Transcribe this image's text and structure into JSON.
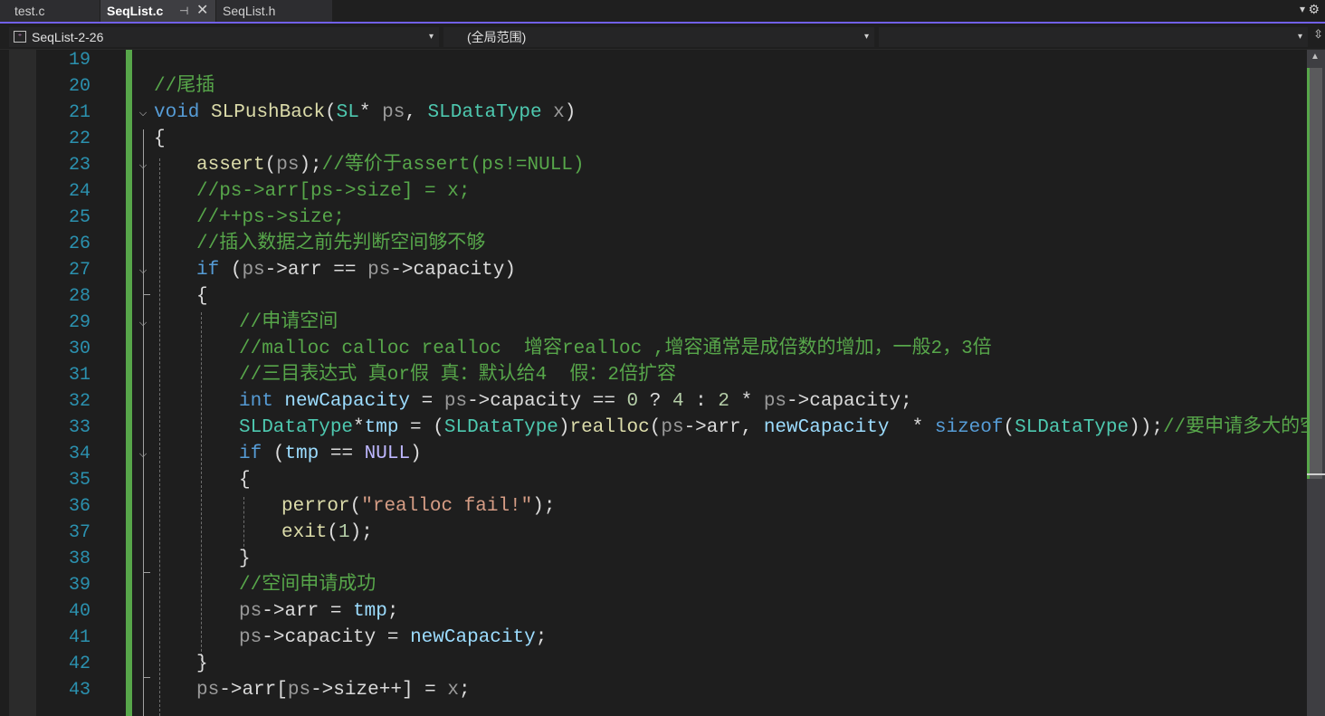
{
  "tabs": [
    {
      "label": "test.c",
      "active": false
    },
    {
      "label": "SeqList.c",
      "active": true,
      "pin_glyph": "⊣",
      "close_glyph": "✕"
    },
    {
      "label": "SeqList.h",
      "active": false
    }
  ],
  "tabstrip": {
    "overflow_glyph": "▾",
    "settings_glyph": "⚙"
  },
  "navbar": {
    "project": "SeqList-2-26",
    "project_icon": "⁺",
    "scope": "(全局范围)",
    "member": "",
    "dropdown_glyph": "▾",
    "split_glyph": "⇳"
  },
  "editor": {
    "fold_glyph": "⌵",
    "scroll_up_glyph": "▲",
    "line_numbers": [
      "19",
      "20",
      "21",
      "22",
      "23",
      "24",
      "25",
      "26",
      "27",
      "28",
      "29",
      "30",
      "31",
      "32",
      "33",
      "34",
      "35",
      "36",
      "37",
      "38",
      "39",
      "40",
      "41",
      "42",
      "43"
    ],
    "lines": {
      "l20": {
        "c": "//尾插"
      },
      "l21": {
        "k": "void",
        "f": "SLPushBack",
        "p1": "(",
        "t1": "SL",
        "s1": "* ",
        "v1": "ps",
        ",": ", ",
        "t2": "SLDataType",
        "v2": " x",
        ")": ")"
      },
      "l22": {
        "b": "{"
      },
      "l23": {
        "f": "assert",
        "p1": "(",
        "v1": "ps",
        "p2": ");",
        "c": "//等价于assert(ps!=NULL)"
      },
      "l24": {
        "c": "//ps->arr[ps->size] = x;"
      },
      "l25": {
        "c": "//++ps->size;"
      },
      "l26": {
        "c": "//插入数据之前先判断空间够不够"
      },
      "l27": {
        "k": "if",
        "a": " (",
        "v1": "ps",
        "o": "->",
        "m1": "arr",
        "e": " == ",
        "v2": "ps",
        "o2": "->",
        "m2": "capacity",
        "z": ")"
      },
      "l28": {
        "b": "{"
      },
      "l29": {
        "c": "//申请空间"
      },
      "l30": {
        "c": "//malloc calloc realloc  增容realloc ,增容通常是成倍数的增加，一般2，3倍"
      },
      "l31": {
        "c": "//三目表达式 真or假 真：默认给4  假：2倍扩容"
      },
      "l32": {
        "k": "int",
        "v0": " newCapacity",
        "e": " = ",
        "v1": "ps",
        "o": "->",
        "m1": "capacity",
        "e2": " == ",
        "n1": "0",
        "q": " ? ",
        "n2": "4",
        "cl": " : ",
        "n3": "2",
        "x": " * ",
        "v2": "ps",
        "o2": "->",
        "m2": "capacity",
        "z": ";"
      },
      "l33": {
        "t1": "SLDataType",
        "s": "*",
        "v0": "tmp",
        "e": " = (",
        "t2": "SLDataType",
        "p": ")",
        "f": "realloc",
        "p1": "(",
        "v1": "ps",
        "o": "->",
        "m1": "arr",
        ",": ", ",
        "v2": "newCapacity",
        "x": "  * ",
        "k": "sizeof",
        "p2": "(",
        "t3": "SLDataType",
        "p3": "));",
        "c": "//要申请多大的空间"
      },
      "l34": {
        "k": "if",
        "a": " (",
        "v0": "tmp",
        "e": " == ",
        "mc": "NULL",
        "z": ")"
      },
      "l35": {
        "b": "{"
      },
      "l36": {
        "f": "perror",
        "p1": "(",
        "s": "\"realloc fail!\"",
        "p2": ");"
      },
      "l37": {
        "f": "exit",
        "p1": "(",
        "n": "1",
        "p2": ");"
      },
      "l38": {
        "b": "}"
      },
      "l39": {
        "c": "//空间申请成功"
      },
      "l40": {
        "v1": "ps",
        "o": "->",
        "m1": "arr",
        "e": " = ",
        "v2": "tmp",
        "z": ";"
      },
      "l41": {
        "v1": "ps",
        "o": "->",
        "m1": "capacity",
        "e": " = ",
        "v2": "newCapacity",
        "z": ";"
      },
      "l42": {
        "b": "}"
      },
      "l43": {
        "v1": "ps",
        "o": "->",
        "m1": "arr",
        "b1": "[",
        "v2": "ps",
        "o2": "->",
        "m2": "size",
        "pp": "++",
        "b2": "]",
        "e": " = ",
        "v3": "x",
        "z": ";"
      }
    }
  },
  "colors": {
    "accent": "#7160e8",
    "change_bar": "#57a64a",
    "keyword": "#569cd6",
    "comment": "#57a64a",
    "type": "#4ec9b0",
    "function": "#dcdcaa",
    "variable": "#9cdcfe",
    "line_number": "#2b91af"
  }
}
